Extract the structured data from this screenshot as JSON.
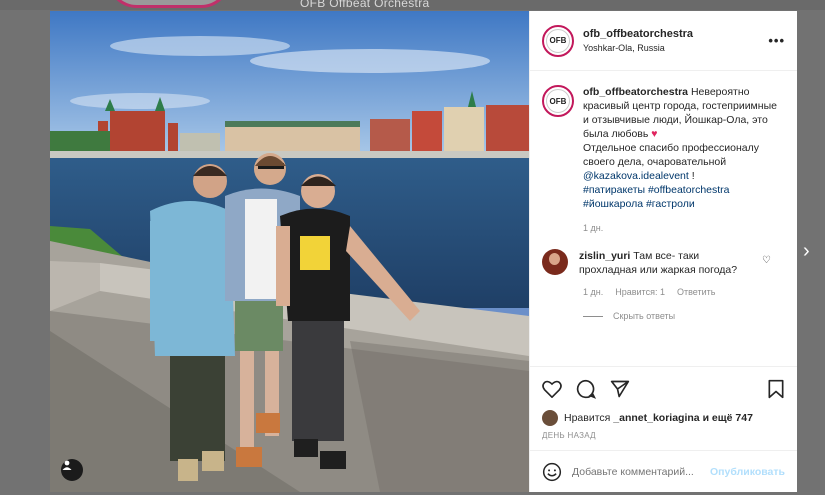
{
  "background": {
    "account_title": "OFB Offbeat Orchestra"
  },
  "post": {
    "avatar_text": "OFB",
    "username": "ofb_offbeatorchestra",
    "location": "Yoshkar-Ola, Russia",
    "more_icon": "ellipsis-icon",
    "caption": {
      "text_part1": "Невероятно красивый центр города, гостеприимные и отзывчивые люди, Йошкар-Ола, это была любовь",
      "text_part2": "Отдельное спасибо профессионалу своего дела, очаровательной",
      "mention": "@kazakova.idealevent",
      "exclaim": "!",
      "hashtags": [
        "#патиракеты",
        "#offbeatorchestra",
        "#йошкарола",
        "#гастроли"
      ],
      "time": "1 дн."
    },
    "comment": {
      "username": "zislin_yuri",
      "text": "Там все- таки прохладная или жаркая погода?",
      "time": "1 дн.",
      "likes": "Нравится: 1",
      "reply": "Ответить",
      "hide_replies": "Скрыть ответы"
    },
    "likes": {
      "prefix": "Нравится",
      "user": "_annet_koriagina",
      "suffix": "и ещё 747"
    },
    "date": "ДЕНЬ НАЗАД",
    "comment_input": {
      "placeholder": "Добавьте комментарий...",
      "submit": "Опубликовать"
    },
    "colors": {
      "accent": "#0095f6",
      "heart": "#e0245e",
      "ring": "#c2185b"
    }
  }
}
